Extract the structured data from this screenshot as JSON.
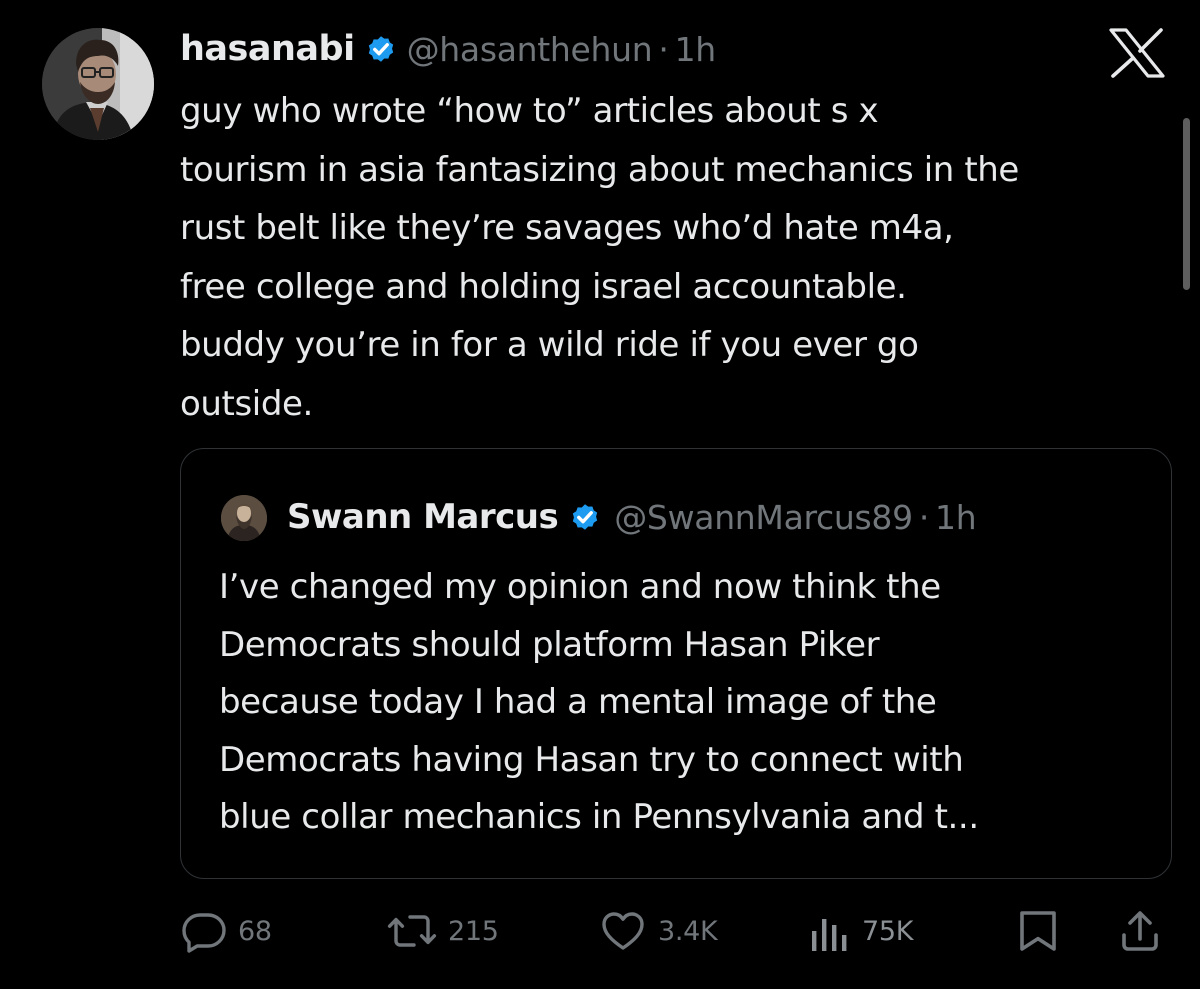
{
  "tweet": {
    "author": {
      "display_name": "hasanabi",
      "handle": "@hasanthehun",
      "separator": "·",
      "time": "1h"
    },
    "text_lines": [
      "guy who wrote “how to” articles about s  x",
      "tourism in asia fantasizing about mechanics in the",
      "rust belt like they’re savages who’d hate m4a,",
      "free college and holding israel accountable.",
      "buddy you’re in for a wild ride if you ever go",
      "outside."
    ]
  },
  "quote": {
    "author": {
      "display_name": "Swann Marcus",
      "handle": "@SwannMarcus89",
      "separator": "·",
      "time": "1h"
    },
    "text_lines": [
      "I’ve changed my opinion and now think the",
      "Democrats should platform Hasan Piker",
      "because today I had a mental image of the",
      "Democrats having Hasan try to connect with",
      "blue collar mechanics in Pennsylvania and t..."
    ]
  },
  "actions": {
    "replies": "68",
    "reposts": "215",
    "likes": "3.4K",
    "views": "75K"
  },
  "icons": {
    "app_logo": "x-logo-icon",
    "verified": "verified-badge-icon",
    "reply": "reply-icon",
    "repost": "repost-icon",
    "like": "heart-icon",
    "views": "views-chart-icon",
    "bookmark": "bookmark-icon",
    "share": "share-icon"
  },
  "colors": {
    "background": "#000000",
    "text_primary": "#e7e9ea",
    "text_secondary": "#71767b",
    "verified_blue": "#1d9bf0",
    "border": "#2f3336"
  }
}
